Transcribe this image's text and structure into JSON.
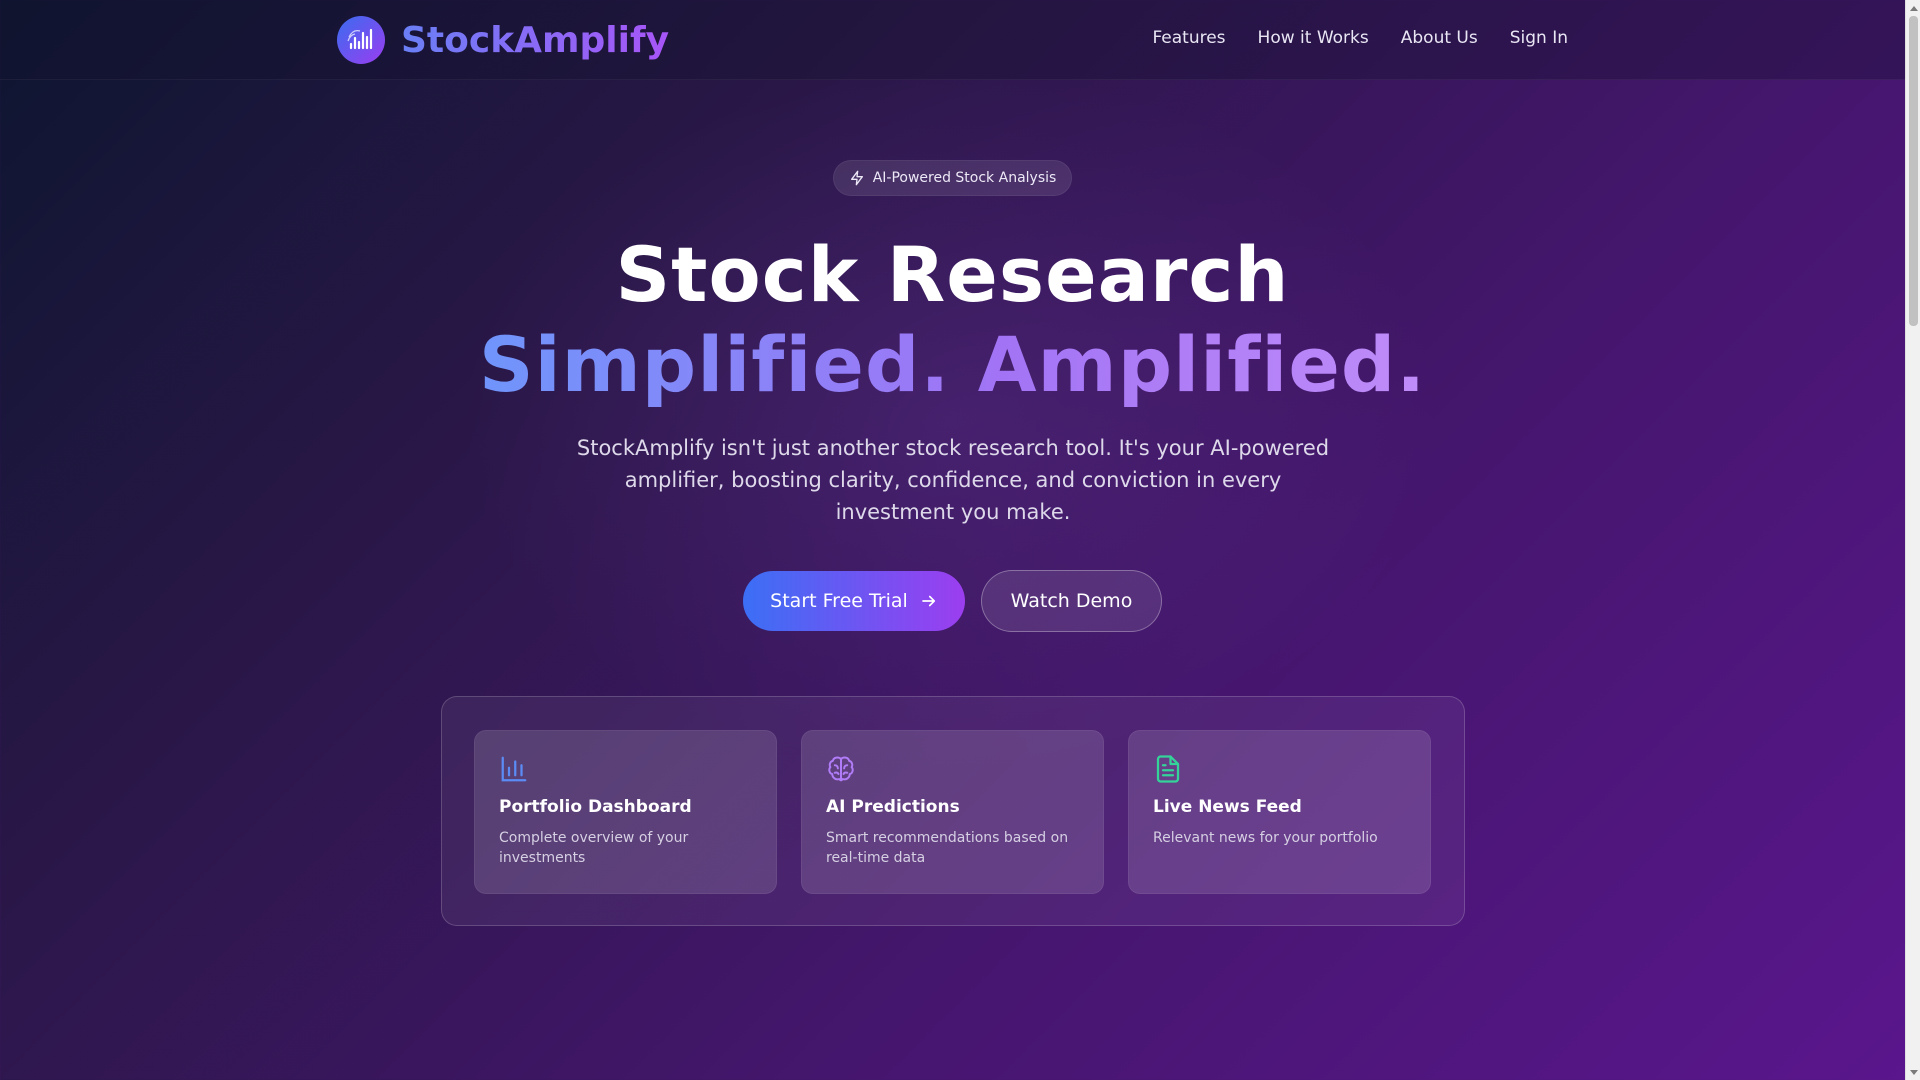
{
  "brand": {
    "name": "StockAmplify"
  },
  "nav": {
    "features": "Features",
    "how_it_works": "How it Works",
    "about": "About Us",
    "sign_in": "Sign In"
  },
  "hero": {
    "badge": "AI-Powered Stock Analysis",
    "title_line1": "Stock Research",
    "title_line2": "Simplified. Amplified.",
    "subtitle": "StockAmplify isn't just another stock research tool. It's your AI-powered amplifier, boosting clarity, confidence, and conviction in every investment you make.",
    "cta_primary": "Start Free Trial",
    "cta_secondary": "Watch Demo"
  },
  "features": [
    {
      "icon": "bar-chart-icon",
      "title": "Portfolio Dashboard",
      "desc": "Complete overview of your investments",
      "color": "#5b8cf5"
    },
    {
      "icon": "brain-icon",
      "title": "AI Predictions",
      "desc": "Smart recommendations based on real-time data",
      "color": "#b07cf7"
    },
    {
      "icon": "document-icon",
      "title": "Live News Feed",
      "desc": "Relevant news for your portfolio",
      "color": "#34d399"
    }
  ],
  "colors": {
    "accent_blue": "#3b6ff5",
    "accent_purple": "#9c3ef0",
    "background_dark": "#0d1630",
    "background_purple": "#5a168d"
  }
}
